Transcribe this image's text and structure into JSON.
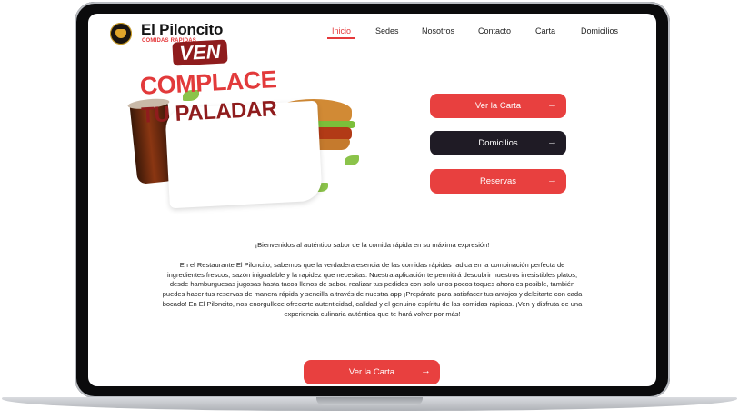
{
  "header": {
    "brand": "El Piloncito",
    "tagline": "COMIDAS RAPIDAS",
    "nav": [
      "Inicio",
      "Sedes",
      "Nosotros",
      "Contacto",
      "Carta",
      "Domicilios"
    ]
  },
  "hero": {
    "line1": "VEN",
    "line2": "COMPLACE",
    "line3": "TU PALADAR"
  },
  "actions": {
    "carta": "Ver la Carta",
    "domicilios": "Domicilios",
    "reservas": "Reservas",
    "arrow": "→"
  },
  "content": {
    "intro": "¡Bienvenidos al auténtico sabor de la comida rápida en su máxima expresión!",
    "paragraph": "En el Restaurante El Piloncito, sabemos que la verdadera esencia de las comidas rápidas radica en la combinación perfecta de ingredientes frescos, sazón inigualable y la rapidez que necesitas. Nuestra aplicación te permitirá descubrir nuestros irresistibles platos, desde hamburguesas jugosas hasta tacos llenos de sabor. realizar tus pedidos con solo unos pocos toques ahora es posible, también puedes hacer tus reservas de manera rápida y sencilla a través de nuestra app ¡Prepárate para satisfacer tus antojos y deleitarte con cada bocado! En El Piloncito, nos enorgullece ofrecerte autenticidad, calidad y el genuino espíritu de las comidas rápidas. ¡Ven y disfruta de una experiencia culinaria auténtica que te hará volver por más!",
    "cta": "Ver la Carta"
  },
  "colors": {
    "accent": "#e8403f",
    "dark": "#1f1b25"
  }
}
